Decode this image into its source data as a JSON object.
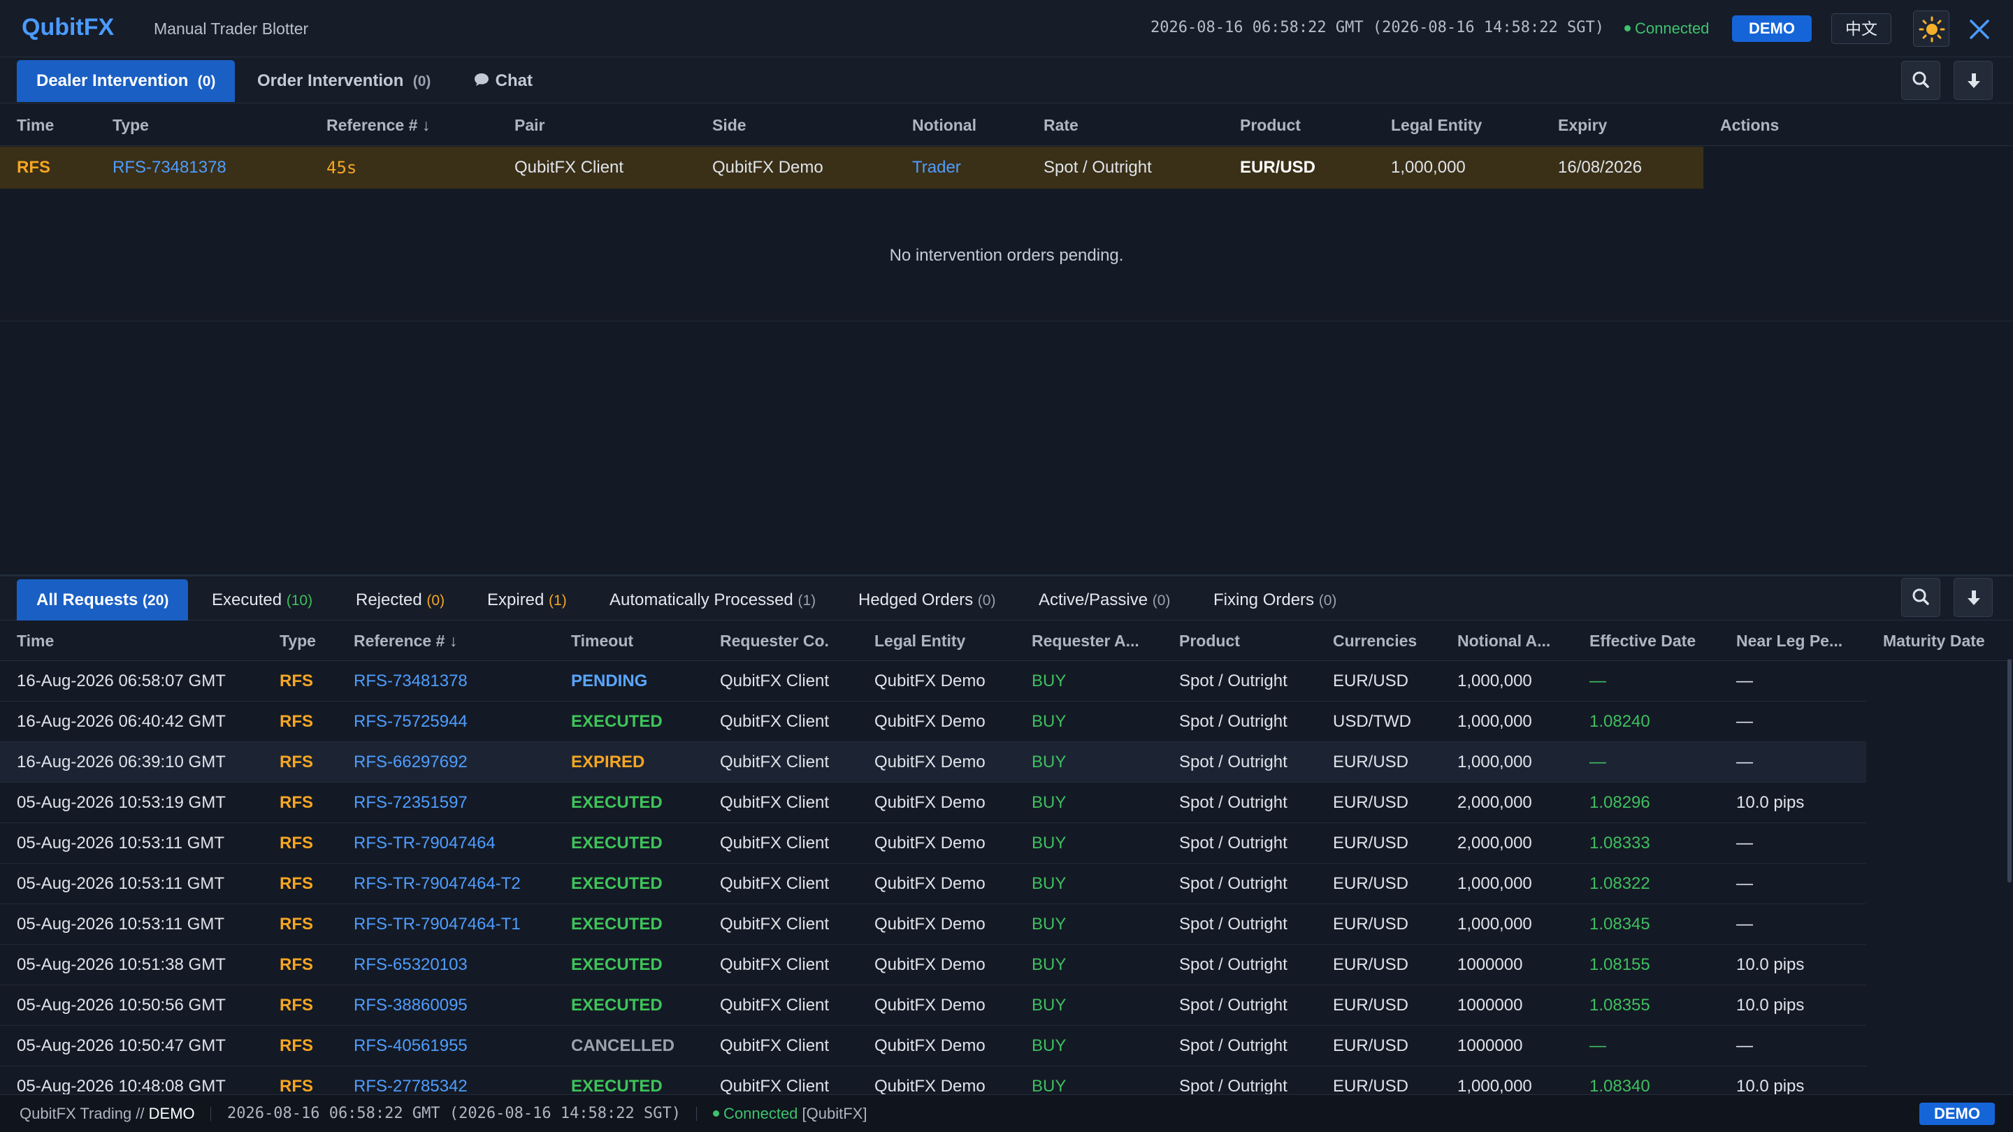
{
  "header": {
    "logo": "QubitFX",
    "subtitle": "Manual Trader Blotter",
    "datetime": "2026-08-16 06:58:22 GMT (2026-08-16 14:58:22 SGT)",
    "status": "Connected",
    "env_badge": "DEMO",
    "language_button": "中文",
    "theme_icon": "sun-icon",
    "close_icon": "close-icon"
  },
  "top_tabs": [
    {
      "label": "Dealer Intervention",
      "count": "(0)",
      "active": true
    },
    {
      "label": "Order Intervention",
      "count": "(0)",
      "active": false
    },
    {
      "label": "Chat",
      "icon": "chat-bubble-icon",
      "active": false
    }
  ],
  "intervention_table": {
    "columns": [
      "Time",
      "Type",
      "Reference #",
      "Pair",
      "Side",
      "Notional",
      "Rate",
      "Product",
      "Legal Entity",
      "Expiry",
      "Actions"
    ],
    "sort_indicator": "↓",
    "row": {
      "time": "RFS",
      "type": "RFS-73481378",
      "reference": "45s",
      "pair": "QubitFX Client",
      "side": "QubitFX Demo",
      "notional": "Trader",
      "rate": "Spot / Outright",
      "product": "EUR/USD",
      "legal_entity": "1,000,000",
      "expiry": "16/08/2026"
    },
    "empty_message": "No intervention orders pending."
  },
  "bottom_tabs": [
    {
      "label": "All Requests",
      "count": "(20)",
      "active": true
    },
    {
      "label": "Executed",
      "count": "(10)",
      "count_color": "#3fbf5f"
    },
    {
      "label": "Rejected",
      "count": "(0)",
      "count_color": "#f5a623"
    },
    {
      "label": "Expired",
      "count": "(1)",
      "count_color": "#f5a623"
    },
    {
      "label": "Automatically Processed",
      "count": "(1)",
      "count_color": "#9aa3b0"
    },
    {
      "label": "Hedged Orders",
      "count": "(0)",
      "count_color": "#9aa3b0"
    },
    {
      "label": "Active/Passive",
      "count": "(0)",
      "count_color": "#9aa3b0"
    },
    {
      "label": "Fixing Orders",
      "count": "(0)",
      "count_color": "#9aa3b0"
    }
  ],
  "requests_table": {
    "columns": [
      "Time",
      "Type",
      "Reference #",
      "Timeout",
      "Requester Co.",
      "Legal Entity",
      "Requester A...",
      "Product",
      "Currencies",
      "Notional A...",
      "Effective Date",
      "Near Leg Pe...",
      "Maturity Date"
    ],
    "sort_indicator": "↓",
    "rows": [
      {
        "time": "16-Aug-2026 06:58:07 GMT",
        "type": "RFS",
        "ref": "RFS-73481378",
        "timeout": "PENDING",
        "requester": "QubitFX Client",
        "entity": "QubitFX Demo",
        "action": "BUY",
        "product": "Spot / Outright",
        "ccy": "EUR/USD",
        "notional": "1,000,000",
        "eff": "—",
        "near": "—"
      },
      {
        "time": "16-Aug-2026 06:40:42 GMT",
        "type": "RFS",
        "ref": "RFS-75725944",
        "timeout": "EXECUTED",
        "requester": "QubitFX Client",
        "entity": "QubitFX Demo",
        "action": "BUY",
        "product": "Spot / Outright",
        "ccy": "USD/TWD",
        "notional": "1,000,000",
        "eff": "1.08240",
        "near": "—"
      },
      {
        "time": "16-Aug-2026 06:39:10 GMT",
        "type": "RFS",
        "ref": "RFS-66297692",
        "timeout": "EXPIRED",
        "requester": "QubitFX Client",
        "entity": "QubitFX Demo",
        "action": "BUY",
        "product": "Spot / Outright",
        "ccy": "EUR/USD",
        "notional": "1,000,000",
        "eff": "—",
        "near": "—"
      },
      {
        "time": "05-Aug-2026 10:53:19 GMT",
        "type": "RFS",
        "ref": "RFS-72351597",
        "timeout": "EXECUTED",
        "requester": "QubitFX Client",
        "entity": "QubitFX Demo",
        "action": "BUY",
        "product": "Spot / Outright",
        "ccy": "EUR/USD",
        "notional": "2,000,000",
        "eff": "1.08296",
        "near": "10.0 pips"
      },
      {
        "time": "05-Aug-2026 10:53:11 GMT",
        "type": "RFS",
        "ref": "RFS-TR-79047464",
        "timeout": "EXECUTED",
        "requester": "QubitFX Client",
        "entity": "QubitFX Demo",
        "action": "BUY",
        "product": "Spot / Outright",
        "ccy": "EUR/USD",
        "notional": "2,000,000",
        "eff": "1.08333",
        "near": "—"
      },
      {
        "time": "05-Aug-2026 10:53:11 GMT",
        "type": "RFS",
        "ref": "RFS-TR-79047464-T2",
        "timeout": "EXECUTED",
        "requester": "QubitFX Client",
        "entity": "QubitFX Demo",
        "action": "BUY",
        "product": "Spot / Outright",
        "ccy": "EUR/USD",
        "notional": "1,000,000",
        "eff": "1.08322",
        "near": "—"
      },
      {
        "time": "05-Aug-2026 10:53:11 GMT",
        "type": "RFS",
        "ref": "RFS-TR-79047464-T1",
        "timeout": "EXECUTED",
        "requester": "QubitFX Client",
        "entity": "QubitFX Demo",
        "action": "BUY",
        "product": "Spot / Outright",
        "ccy": "EUR/USD",
        "notional": "1,000,000",
        "eff": "1.08345",
        "near": "—"
      },
      {
        "time": "05-Aug-2026 10:51:38 GMT",
        "type": "RFS",
        "ref": "RFS-65320103",
        "timeout": "EXECUTED",
        "requester": "QubitFX Client",
        "entity": "QubitFX Demo",
        "action": "BUY",
        "product": "Spot / Outright",
        "ccy": "EUR/USD",
        "notional": "1000000",
        "eff": "1.08155",
        "near": "10.0 pips"
      },
      {
        "time": "05-Aug-2026 10:50:56 GMT",
        "type": "RFS",
        "ref": "RFS-38860095",
        "timeout": "EXECUTED",
        "requester": "QubitFX Client",
        "entity": "QubitFX Demo",
        "action": "BUY",
        "product": "Spot / Outright",
        "ccy": "EUR/USD",
        "notional": "1000000",
        "eff": "1.08355",
        "near": "10.0 pips"
      },
      {
        "time": "05-Aug-2026 10:50:47 GMT",
        "type": "RFS",
        "ref": "RFS-40561955",
        "timeout": "CANCELLED",
        "requester": "QubitFX Client",
        "entity": "QubitFX Demo",
        "action": "BUY",
        "product": "Spot / Outright",
        "ccy": "EUR/USD",
        "notional": "1000000",
        "eff": "—",
        "near": "—"
      },
      {
        "time": "05-Aug-2026 10:48:08 GMT",
        "type": "RFS",
        "ref": "RFS-27785342",
        "timeout": "EXECUTED",
        "requester": "QubitFX Client",
        "entity": "QubitFX Demo",
        "action": "BUY",
        "product": "Spot / Outright",
        "ccy": "EUR/USD",
        "notional": "1,000,000",
        "eff": "1.08340",
        "near": "10.0 pips"
      }
    ]
  },
  "footer": {
    "brand": "QubitFX Trading //",
    "env": "DEMO",
    "datetime": "2026-08-16 06:58:22 GMT (2026-08-16 14:58:22 SGT)",
    "status": "Connected",
    "server": "[QubitFX]",
    "env_badge": "DEMO"
  },
  "colors": {
    "accent": "#1a5fc4",
    "rfs": "#f5a623",
    "link": "#4f9dff",
    "buy": "#3fbf5f",
    "pending_row": "#3a2f17"
  }
}
